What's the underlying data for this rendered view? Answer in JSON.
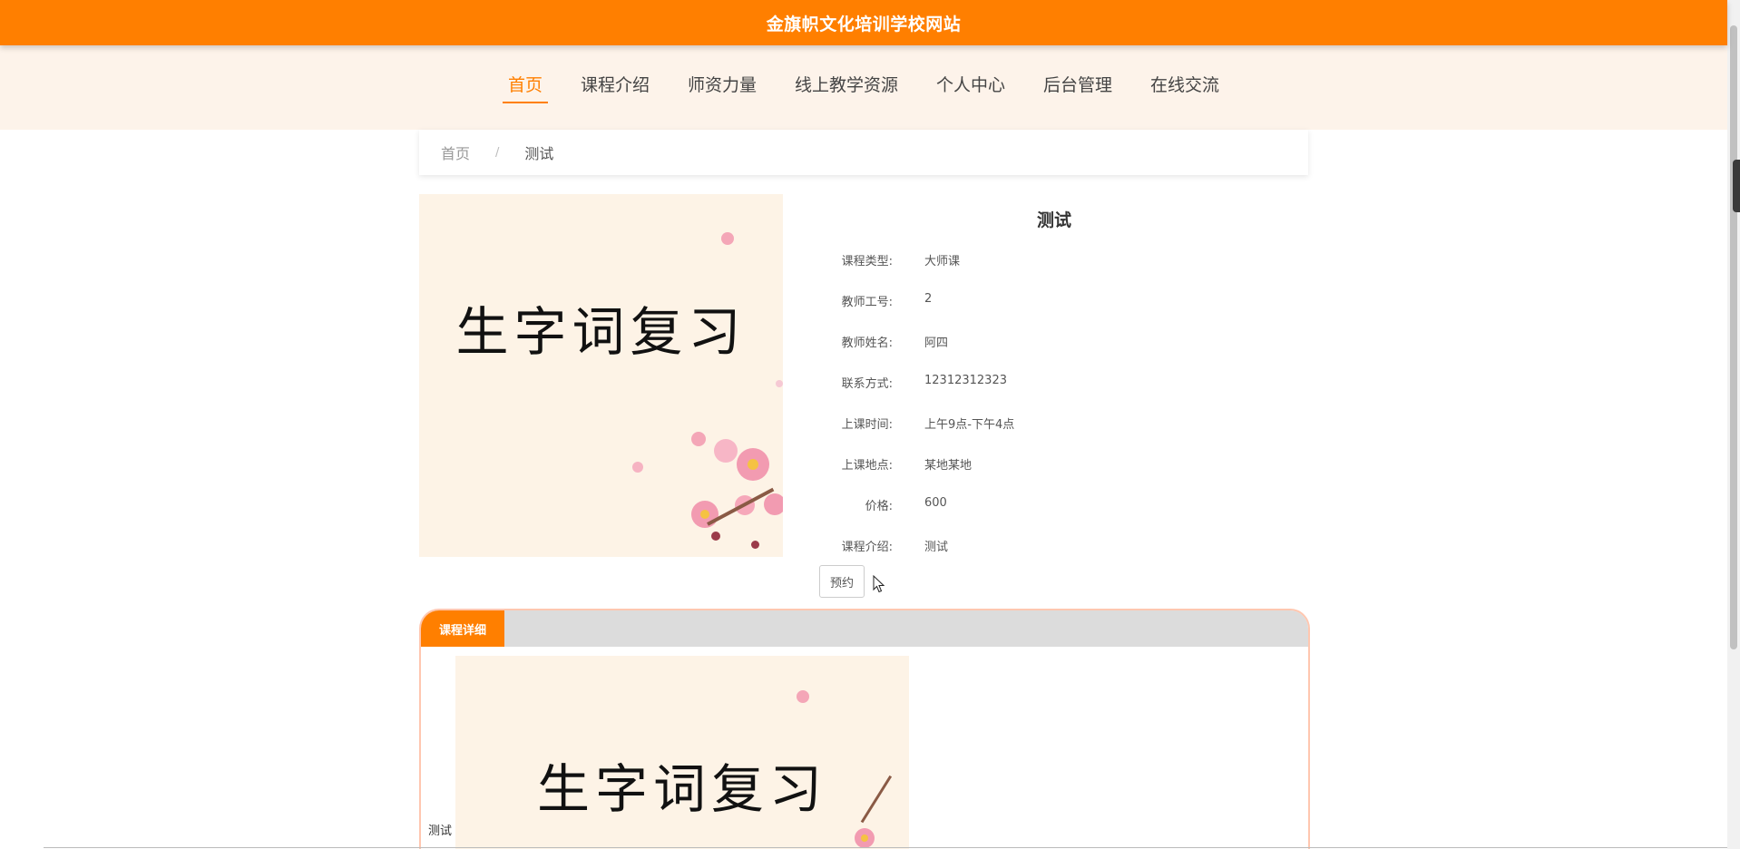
{
  "header": {
    "site_title": "金旗帜文化培训学校网站"
  },
  "nav": {
    "items": [
      {
        "label": "首页",
        "active": true
      },
      {
        "label": "课程介绍",
        "active": false
      },
      {
        "label": "师资力量",
        "active": false
      },
      {
        "label": "线上教学资源",
        "active": false
      },
      {
        "label": "个人中心",
        "active": false
      },
      {
        "label": "后台管理",
        "active": false
      },
      {
        "label": "在线交流",
        "active": false
      }
    ]
  },
  "breadcrumb": {
    "home": "首页",
    "separator": "/",
    "current": "测试"
  },
  "course": {
    "image_text": "生字词复习",
    "title": "测试",
    "fields": [
      {
        "label": "课程类型:",
        "value": "大师课"
      },
      {
        "label": "教师工号:",
        "value": "2"
      },
      {
        "label": "教师姓名:",
        "value": "阿四"
      },
      {
        "label": "联系方式:",
        "value": "12312312323"
      },
      {
        "label": "上课时间:",
        "value": "上午9点-下午4点"
      },
      {
        "label": "上课地点:",
        "value": "某地某地"
      },
      {
        "label": "价格:",
        "value": "600"
      },
      {
        "label": "课程介绍:",
        "value": "测试"
      }
    ],
    "book_label": "预约"
  },
  "detail_panel": {
    "tab_label": "课程详细",
    "caption": "测试",
    "image_text": "生字词复习"
  },
  "colors": {
    "accent": "#ff7f00",
    "nav_bg": "#fdf3ea",
    "image_bg": "#fdf3e6",
    "panel_border": "#ffc7b0"
  }
}
